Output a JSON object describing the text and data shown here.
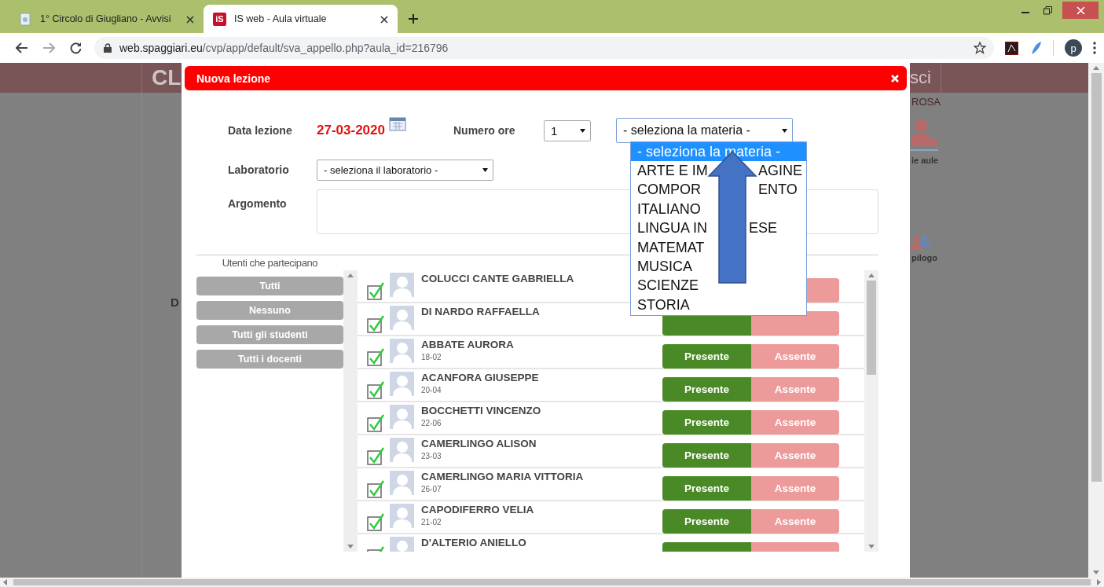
{
  "browser": {
    "tabs": [
      {
        "title": "1° Circolo di Giugliano - Avvisi",
        "selected": false
      },
      {
        "title": "IS web - Aula virtuale",
        "selected": true
      }
    ],
    "tab_icon_text": "iS",
    "profile_initial": "p",
    "address": {
      "host": "web.spaggiari.eu",
      "path": "/cvp/app/default/sva_appello.php?aula_id=216796"
    }
  },
  "background": {
    "header_text": "CL",
    "header_right_text": "sci",
    "right_caption": "ROSA",
    "right_links": [
      "ie aule",
      "pilogo"
    ],
    "left_text": "D"
  },
  "modal": {
    "title": "Nuova lezione",
    "date_label": "Data lezione",
    "date": "27-03-2020",
    "hours_label": "Numero ore",
    "hours": "1",
    "subject_select": {
      "value": "- seleziona la materia -",
      "expanded": true,
      "options": [
        {
          "label": "- seleziona la materia -",
          "selected": true
        },
        {
          "label": "ARTE E IM",
          "tail": "AGINE",
          "selected": false
        },
        {
          "label": "COMPOR",
          "tail": "ENTO",
          "selected": false
        },
        {
          "label": "ITALIANO",
          "selected": false
        },
        {
          "label": "LINGUA IN",
          "tail": "ESE",
          "selected": false
        },
        {
          "label": "MATEMAT",
          "selected": false
        },
        {
          "label": "MUSICA",
          "selected": false
        },
        {
          "label": "SCIENZE",
          "selected": false
        },
        {
          "label": "STORIA",
          "selected": false
        }
      ]
    },
    "lab_label": "Laboratorio",
    "lab": "- seleziona il laboratorio -",
    "topic_label": "Argomento",
    "participants_label": "Utenti che partecipano",
    "filter_buttons": [
      "Tutti",
      "Nessuno",
      "Tutti gli studenti",
      "Tutti i docenti"
    ],
    "users": [
      {
        "name": "COLUCCI CANTE GABRIELLA",
        "checked": true
      },
      {
        "name": "DI NARDO RAFFAELLA",
        "checked": true,
        "present": true
      },
      {
        "name": "ABBATE AURORA",
        "date": "18-02",
        "checked": true,
        "present": true,
        "present_label": "Presente",
        "absent_label": "Assente"
      },
      {
        "name": "ACANFORA GIUSEPPE",
        "date": "20-04",
        "checked": true,
        "present": true,
        "present_label": "Presente",
        "absent_label": "Assente"
      },
      {
        "name": "BOCCHETTI VINCENZO",
        "date": "22-06",
        "checked": true,
        "present": true,
        "present_label": "Presente",
        "absent_label": "Assente"
      },
      {
        "name": "CAMERLINGO ALISON",
        "date": "23-03",
        "checked": true,
        "present": true,
        "present_label": "Presente",
        "absent_label": "Assente"
      },
      {
        "name": "CAMERLINGO MARIA VITTORIA",
        "date": "26-07",
        "checked": true,
        "present": true,
        "present_label": "Presente",
        "absent_label": "Assente"
      },
      {
        "name": "CAPODIFERRO VELIA",
        "date": "21-02",
        "checked": true,
        "present": true,
        "present_label": "Presente",
        "absent_label": "Assente"
      },
      {
        "name": "D'ALTERIO ANIELLO",
        "checked": true,
        "present": true
      }
    ]
  }
}
